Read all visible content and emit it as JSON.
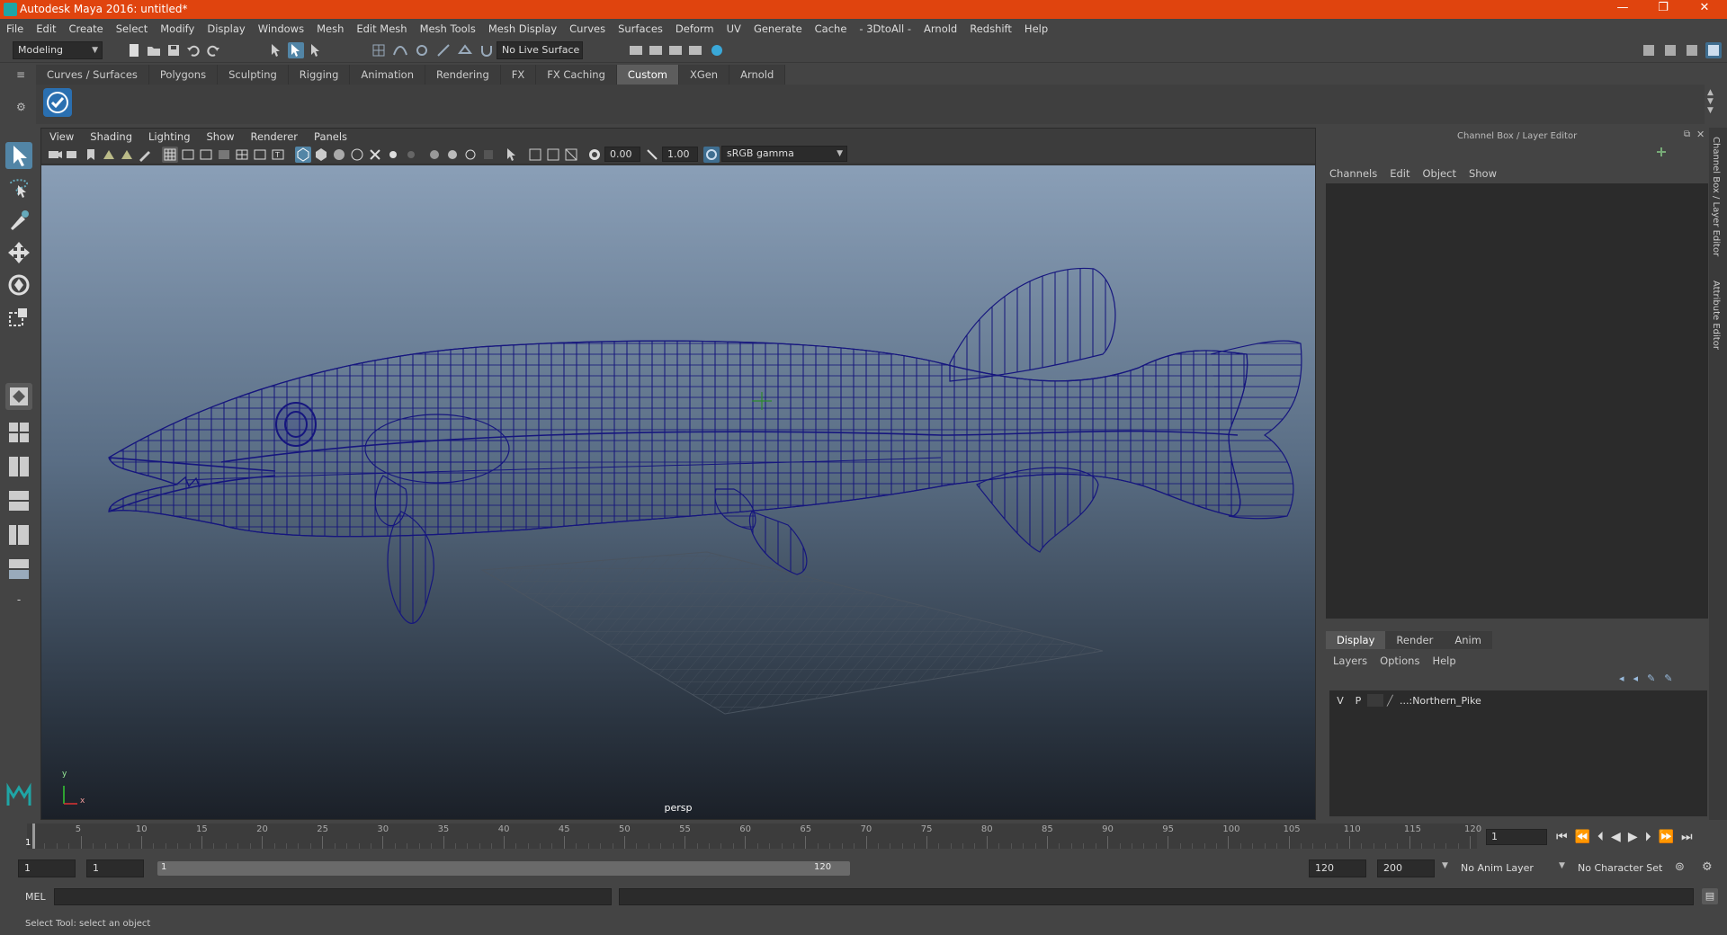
{
  "window": {
    "title": "Autodesk Maya 2016: untitled*",
    "minimize": "—",
    "restore": "❐",
    "close": "✕"
  },
  "menubar": [
    "File",
    "Edit",
    "Create",
    "Select",
    "Modify",
    "Display",
    "Windows",
    "Mesh",
    "Edit Mesh",
    "Mesh Tools",
    "Mesh Display",
    "Curves",
    "Surfaces",
    "Deform",
    "UV",
    "Generate",
    "Cache",
    "- 3DtoAll -",
    "Arnold",
    "Redshift",
    "Help"
  ],
  "status": {
    "mode": "Modeling",
    "live_surface": "No Live Surface"
  },
  "shelf": {
    "tabs": [
      "Curves / Surfaces",
      "Polygons",
      "Sculpting",
      "Rigging",
      "Animation",
      "Rendering",
      "FX",
      "FX Caching",
      "Custom",
      "XGen",
      "Arnold"
    ],
    "active_tab": "Custom"
  },
  "viewport": {
    "menu": [
      "View",
      "Shading",
      "Lighting",
      "Show",
      "Renderer",
      "Panels"
    ],
    "exposure": "0.00",
    "gamma": "1.00",
    "color_space": "sRGB gamma",
    "camera": "persp",
    "axis_y": "y",
    "axis_x": "x"
  },
  "channel_box": {
    "header": "Channel Box / Layer Editor",
    "menu": [
      "Channels",
      "Edit",
      "Object",
      "Show"
    ]
  },
  "layer_editor": {
    "tabs": [
      "Display",
      "Render",
      "Anim"
    ],
    "active_tab": "Display",
    "menu": [
      "Layers",
      "Options",
      "Help"
    ],
    "layer": {
      "v": "V",
      "p": "P",
      "name": "...:Northern_Pike"
    }
  },
  "side_tabs": [
    "Channel Box / Layer Editor",
    "Attribute Editor"
  ],
  "timeline": {
    "ticks": [
      "5",
      "10",
      "15",
      "20",
      "25",
      "30",
      "35",
      "40",
      "45",
      "50",
      "55",
      "60",
      "65",
      "70",
      "75",
      "80",
      "85",
      "90",
      "95",
      "100",
      "105",
      "110",
      "115",
      "120"
    ],
    "current_marker": "1",
    "current_frame": "1"
  },
  "range": {
    "start": "1",
    "start_inner": "1",
    "slider_start": "1",
    "slider_end": "120",
    "end_inner": "120",
    "end": "200",
    "anim_layer": "No Anim Layer",
    "char_set": "No Character Set"
  },
  "cmdline": {
    "lang": "MEL"
  },
  "helpline": {
    "text": "Select Tool: select an object"
  }
}
